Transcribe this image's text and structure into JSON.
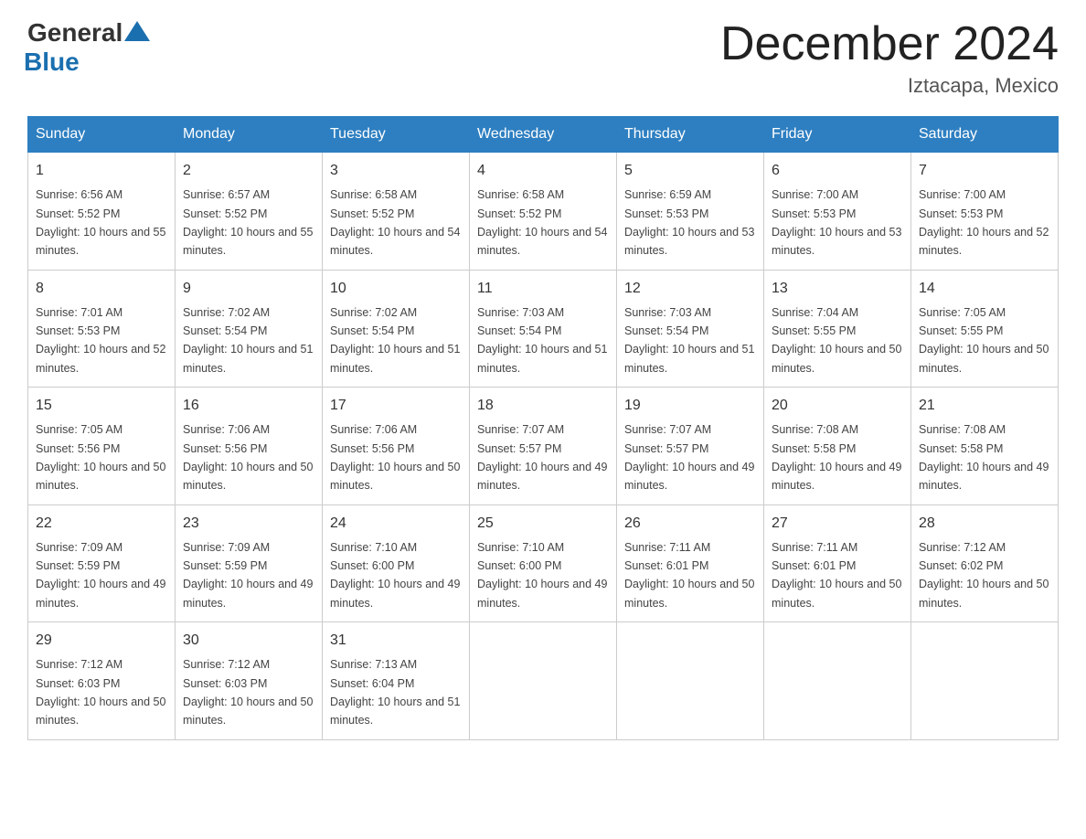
{
  "header": {
    "logo_general": "General",
    "logo_blue": "Blue",
    "month_title": "December 2024",
    "location": "Iztacapa, Mexico"
  },
  "days_of_week": [
    "Sunday",
    "Monday",
    "Tuesday",
    "Wednesday",
    "Thursday",
    "Friday",
    "Saturday"
  ],
  "weeks": [
    [
      {
        "day": "1",
        "sunrise": "6:56 AM",
        "sunset": "5:52 PM",
        "daylight": "10 hours and 55 minutes."
      },
      {
        "day": "2",
        "sunrise": "6:57 AM",
        "sunset": "5:52 PM",
        "daylight": "10 hours and 55 minutes."
      },
      {
        "day": "3",
        "sunrise": "6:58 AM",
        "sunset": "5:52 PM",
        "daylight": "10 hours and 54 minutes."
      },
      {
        "day": "4",
        "sunrise": "6:58 AM",
        "sunset": "5:52 PM",
        "daylight": "10 hours and 54 minutes."
      },
      {
        "day": "5",
        "sunrise": "6:59 AM",
        "sunset": "5:53 PM",
        "daylight": "10 hours and 53 minutes."
      },
      {
        "day": "6",
        "sunrise": "7:00 AM",
        "sunset": "5:53 PM",
        "daylight": "10 hours and 53 minutes."
      },
      {
        "day": "7",
        "sunrise": "7:00 AM",
        "sunset": "5:53 PM",
        "daylight": "10 hours and 52 minutes."
      }
    ],
    [
      {
        "day": "8",
        "sunrise": "7:01 AM",
        "sunset": "5:53 PM",
        "daylight": "10 hours and 52 minutes."
      },
      {
        "day": "9",
        "sunrise": "7:02 AM",
        "sunset": "5:54 PM",
        "daylight": "10 hours and 51 minutes."
      },
      {
        "day": "10",
        "sunrise": "7:02 AM",
        "sunset": "5:54 PM",
        "daylight": "10 hours and 51 minutes."
      },
      {
        "day": "11",
        "sunrise": "7:03 AM",
        "sunset": "5:54 PM",
        "daylight": "10 hours and 51 minutes."
      },
      {
        "day": "12",
        "sunrise": "7:03 AM",
        "sunset": "5:54 PM",
        "daylight": "10 hours and 51 minutes."
      },
      {
        "day": "13",
        "sunrise": "7:04 AM",
        "sunset": "5:55 PM",
        "daylight": "10 hours and 50 minutes."
      },
      {
        "day": "14",
        "sunrise": "7:05 AM",
        "sunset": "5:55 PM",
        "daylight": "10 hours and 50 minutes."
      }
    ],
    [
      {
        "day": "15",
        "sunrise": "7:05 AM",
        "sunset": "5:56 PM",
        "daylight": "10 hours and 50 minutes."
      },
      {
        "day": "16",
        "sunrise": "7:06 AM",
        "sunset": "5:56 PM",
        "daylight": "10 hours and 50 minutes."
      },
      {
        "day": "17",
        "sunrise": "7:06 AM",
        "sunset": "5:56 PM",
        "daylight": "10 hours and 50 minutes."
      },
      {
        "day": "18",
        "sunrise": "7:07 AM",
        "sunset": "5:57 PM",
        "daylight": "10 hours and 49 minutes."
      },
      {
        "day": "19",
        "sunrise": "7:07 AM",
        "sunset": "5:57 PM",
        "daylight": "10 hours and 49 minutes."
      },
      {
        "day": "20",
        "sunrise": "7:08 AM",
        "sunset": "5:58 PM",
        "daylight": "10 hours and 49 minutes."
      },
      {
        "day": "21",
        "sunrise": "7:08 AM",
        "sunset": "5:58 PM",
        "daylight": "10 hours and 49 minutes."
      }
    ],
    [
      {
        "day": "22",
        "sunrise": "7:09 AM",
        "sunset": "5:59 PM",
        "daylight": "10 hours and 49 minutes."
      },
      {
        "day": "23",
        "sunrise": "7:09 AM",
        "sunset": "5:59 PM",
        "daylight": "10 hours and 49 minutes."
      },
      {
        "day": "24",
        "sunrise": "7:10 AM",
        "sunset": "6:00 PM",
        "daylight": "10 hours and 49 minutes."
      },
      {
        "day": "25",
        "sunrise": "7:10 AM",
        "sunset": "6:00 PM",
        "daylight": "10 hours and 49 minutes."
      },
      {
        "day": "26",
        "sunrise": "7:11 AM",
        "sunset": "6:01 PM",
        "daylight": "10 hours and 50 minutes."
      },
      {
        "day": "27",
        "sunrise": "7:11 AM",
        "sunset": "6:01 PM",
        "daylight": "10 hours and 50 minutes."
      },
      {
        "day": "28",
        "sunrise": "7:12 AM",
        "sunset": "6:02 PM",
        "daylight": "10 hours and 50 minutes."
      }
    ],
    [
      {
        "day": "29",
        "sunrise": "7:12 AM",
        "sunset": "6:03 PM",
        "daylight": "10 hours and 50 minutes."
      },
      {
        "day": "30",
        "sunrise": "7:12 AM",
        "sunset": "6:03 PM",
        "daylight": "10 hours and 50 minutes."
      },
      {
        "day": "31",
        "sunrise": "7:13 AM",
        "sunset": "6:04 PM",
        "daylight": "10 hours and 51 minutes."
      },
      null,
      null,
      null,
      null
    ]
  ]
}
